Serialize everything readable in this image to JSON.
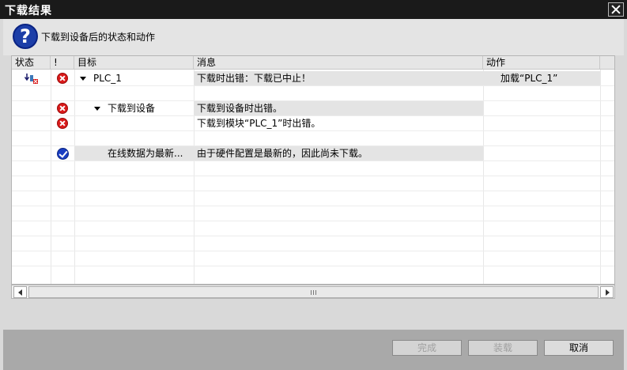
{
  "dialog": {
    "title": "下载结果",
    "header_text": "下载到设备后的状态和动作"
  },
  "table": {
    "headers": [
      "状态",
      "!",
      "目标",
      "消息",
      "动作"
    ],
    "rows": [
      {
        "status_icon": "download-error-icon",
        "severity_icon": "error-icon",
        "target": "PLC_1",
        "expanded": true,
        "message": "下载时出错：下载已中止！",
        "action": "加载“PLC_1”"
      },
      {
        "status_icon": "",
        "severity_icon": "",
        "target": "",
        "message": "",
        "action": ""
      },
      {
        "status_icon": "",
        "severity_icon": "error-icon",
        "target": "下载到设备",
        "expanded": true,
        "message": "下载到设备时出错。",
        "action": ""
      },
      {
        "status_icon": "",
        "severity_icon": "error-icon",
        "target": "",
        "message": "下载到模块“PLC_1”时出错。",
        "action": ""
      },
      {
        "status_icon": "",
        "severity_icon": "",
        "target": "",
        "message": "",
        "action": ""
      },
      {
        "status_icon": "",
        "severity_icon": "check-icon",
        "target": "在线数据为最新...",
        "message": "由于硬件配置是最新的，因此尚未下载。",
        "action": ""
      }
    ]
  },
  "buttons": {
    "finish": "完成",
    "load": "装载",
    "cancel": "取消"
  },
  "colors": {
    "titlebar": "#1a1a1a",
    "error": "#d91a1a",
    "ok": "#1a3ec2",
    "footer": "#a9a9a9"
  }
}
